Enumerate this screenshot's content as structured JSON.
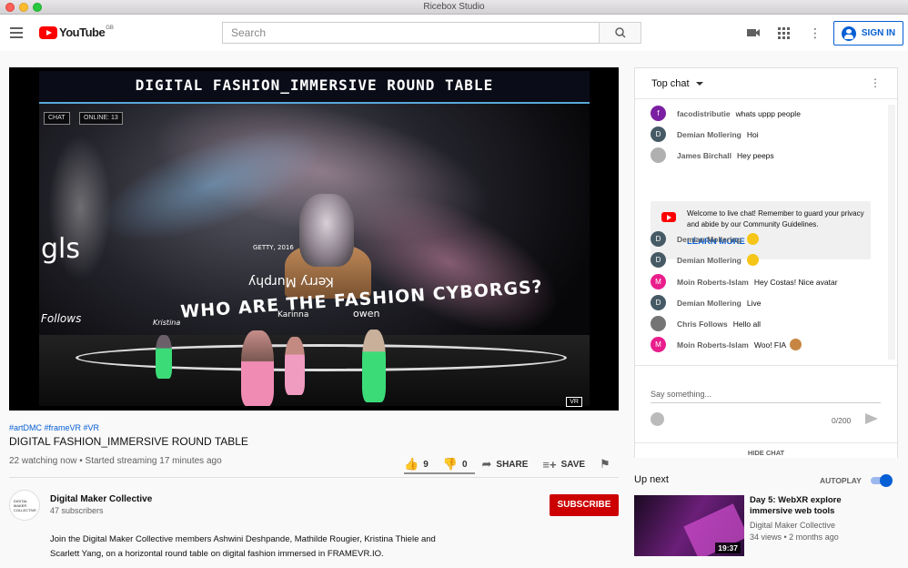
{
  "window": {
    "title": "Ricebox Studio"
  },
  "header": {
    "logo_text": "YouTube",
    "logo_region": "GB",
    "search_placeholder": "Search",
    "signin_label": "SIGN IN"
  },
  "video": {
    "overlay_title": "DIGITAL FASHION_IMMERSIVE ROUND TABLE",
    "overlay_chat_label": "CHAT",
    "overlay_online_label": "ONLINE: 13",
    "overlay_scene_texts": {
      "left_big": "gls",
      "follows": "Follows",
      "getty": "GETTY, 2016",
      "cyborgs": "WHO ARE THE FASHION CYBORGS?",
      "kerry": "Kerry Murphy",
      "karina": "Karinna",
      "kristina": "Kristina",
      "owen": "owen"
    },
    "vr_badge": "VR",
    "tags": "#artDMC #frameVR #VR",
    "title": "DIGITAL FASHION_IMMERSIVE ROUND TABLE",
    "views": "22 watching now • Started streaming 17 minutes ago",
    "likes": "9",
    "dislikes": "0",
    "share_label": "SHARE",
    "save_label": "SAVE"
  },
  "channel": {
    "avatar_text": "DIGITAL MAKER COLLECTIVE",
    "name": "Digital Maker Collective",
    "subscribers": "47 subscribers",
    "subscribe_label": "SUBSCRIBE",
    "description": "Join the Digital Maker Collective members Ashwini Deshpande, Mathilde Rougier, Kristina Thiele and Scarlett Yang, on a horizontal round table on digital fashion immersed in FRAMEVR.IO."
  },
  "chat": {
    "header": "Top chat",
    "messages": [
      {
        "initial": "f",
        "color": "#7b1fa2",
        "author": "facodistributie",
        "text": "whats uppp people"
      },
      {
        "initial": "D",
        "color": "#455a64",
        "author": "Demian Mollering",
        "text": "Hoi"
      },
      {
        "initial": "",
        "color": "#9e9e9e",
        "author": "James Birchall",
        "text": "Hey peeps"
      },
      {
        "initial": "D",
        "color": "#455a64",
        "author": "Demian Mollering",
        "text": ""
      },
      {
        "initial": "D",
        "color": "#455a64",
        "author": "Demian Mollering",
        "text": ""
      },
      {
        "initial": "M",
        "color": "#e91e8c",
        "author": "Moin Roberts-Islam",
        "text": "Hey Costas! Nice avatar"
      },
      {
        "initial": "D",
        "color": "#455a64",
        "author": "Demian Mollering",
        "text": "Live"
      },
      {
        "initial": "",
        "color": "#757575",
        "author": "Chris Follows",
        "text": "Hello all"
      },
      {
        "initial": "M",
        "color": "#e91e8c",
        "author": "Moin Roberts-Islam",
        "text": "Woo! FIA"
      }
    ],
    "welcome_text": "Welcome to live chat! Remember to guard your privacy and abide by our Community Guidelines.",
    "learn_more": "LEARN MORE",
    "input_placeholder": "Say something...",
    "counter": "0/200",
    "hide_chat": "HIDE CHAT"
  },
  "sidebar": {
    "up_next": "Up next",
    "autoplay_label": "AUTOPLAY",
    "autoplay_on": true,
    "recommendation": {
      "title": "Day 5: WebXR explore immersive web tools",
      "channel": "Digital Maker Collective",
      "meta": "34 views • 2 months ago",
      "duration": "19:37"
    }
  }
}
